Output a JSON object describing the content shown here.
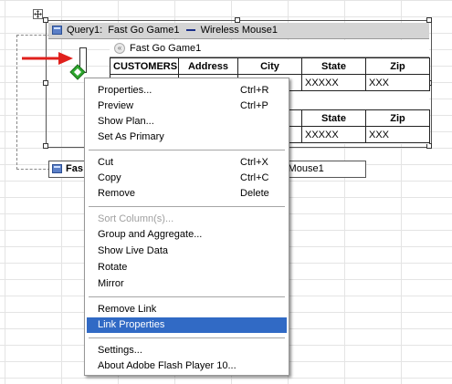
{
  "query_window": {
    "title_prefix": "Query1:",
    "title_game": "Fast Go Game1",
    "title_product": "Wireless Mouse1"
  },
  "table_panel": {
    "subtitle": "Fast Go Game1",
    "header_row_1": [
      "CUSTOMERS",
      "Address",
      "City",
      "State",
      "Zip"
    ],
    "data_row_1": [
      "",
      "",
      "",
      "XXXXX",
      "XXX"
    ],
    "header_row_2": [
      "",
      "",
      "",
      "State",
      "Zip"
    ],
    "data_row_2": [
      "",
      "",
      "",
      "XXXXX",
      "XXX"
    ]
  },
  "second_window": {
    "left_text": "Fas",
    "right_text": "s Mouse1"
  },
  "context_menu": {
    "items": [
      {
        "label": "Properties...",
        "shortcut": "Ctrl+R",
        "disabled": false
      },
      {
        "label": "Preview",
        "shortcut": "Ctrl+P",
        "disabled": false
      },
      {
        "label": "Show Plan...",
        "shortcut": "",
        "disabled": false
      },
      {
        "label": "Set As Primary",
        "shortcut": "",
        "disabled": false
      },
      {
        "label": "Cut",
        "shortcut": "Ctrl+X",
        "disabled": false
      },
      {
        "label": "Copy",
        "shortcut": "Ctrl+C",
        "disabled": false
      },
      {
        "label": "Remove",
        "shortcut": "Delete",
        "disabled": false
      },
      {
        "label": "Sort Column(s)...",
        "shortcut": "",
        "disabled": true
      },
      {
        "label": "Group and Aggregate...",
        "shortcut": "",
        "disabled": false
      },
      {
        "label": "Show Live Data",
        "shortcut": "",
        "disabled": false
      },
      {
        "label": "Rotate",
        "shortcut": "",
        "disabled": false
      },
      {
        "label": "Mirror",
        "shortcut": "",
        "disabled": false
      },
      {
        "label": "Remove Link",
        "shortcut": "",
        "disabled": false
      },
      {
        "label": "Link Properties",
        "shortcut": "",
        "disabled": false,
        "highlighted": true
      },
      {
        "label": "Settings...",
        "shortcut": "",
        "disabled": false
      },
      {
        "label": "About Adobe Flash Player 10...",
        "shortcut": "",
        "disabled": false
      }
    ]
  },
  "icons": {
    "move_handle": "move-cross-icon",
    "window_icon": "query-window-icon",
    "pointer_arrow": "red-arrow-icon",
    "link_node": "green-diamond-icon",
    "collapse": "collapse-chevron-icon"
  },
  "colors": {
    "highlight": "#316ac5",
    "arrow": "#e0201c",
    "diamond": "#2ea82e",
    "titlebar": "#d4d4d4"
  }
}
